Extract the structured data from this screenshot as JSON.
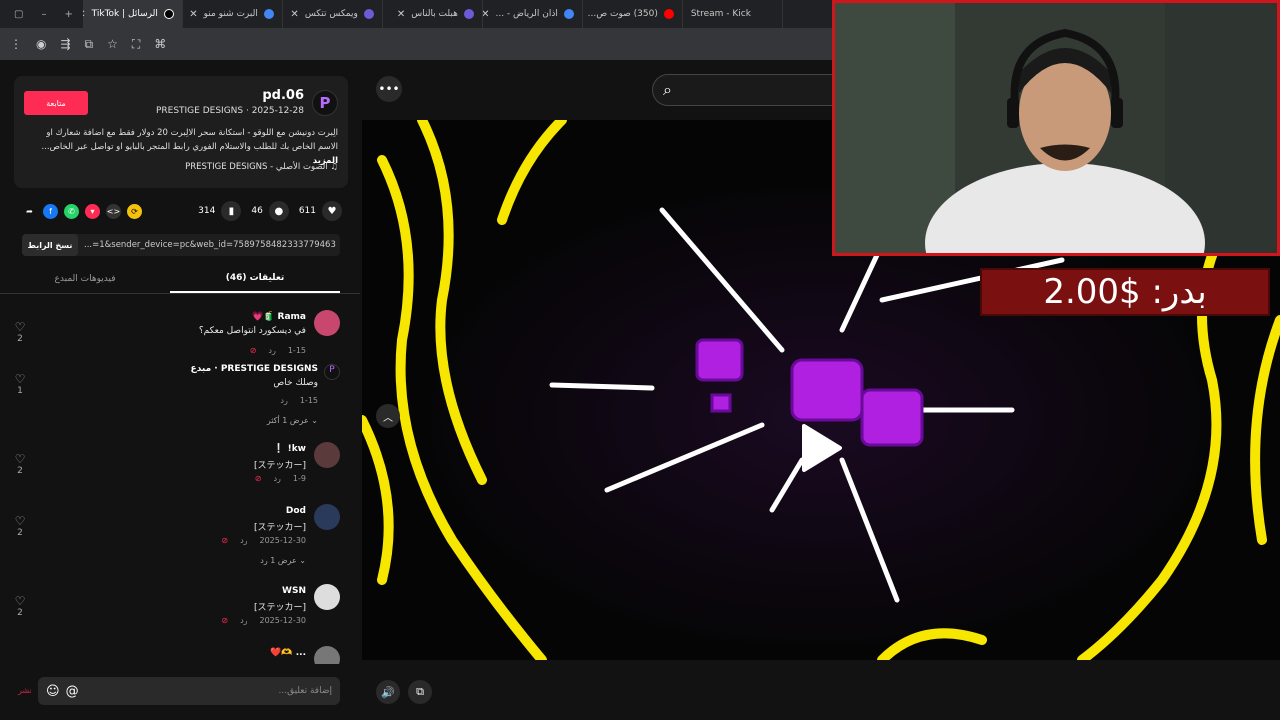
{
  "browser": {
    "tabs": [
      {
        "title": "Stream - Kick",
        "color": "#53fc18"
      },
      {
        "title": "(350) صوت ص...",
        "color": "#ff0000"
      },
      {
        "title": "اذان الرياض - ...",
        "color": "#4285f4"
      },
      {
        "title": "هبلت بالناس",
        "color": "#6b5bd6"
      },
      {
        "title": "ويمكس تتكس",
        "color": "#6b5bd6"
      },
      {
        "title": "البرت شنو منو",
        "color": "#4285f4"
      },
      {
        "title": "الرسائل | TikTok",
        "color": "#000000",
        "active": true
      }
    ],
    "window_controls": [
      "+",
      "–",
      "▢"
    ]
  },
  "post": {
    "author_name": "pd.06",
    "author_sub": "PRESTIGE DESIGNS · 2025-12-28",
    "follow_label": "متابعة",
    "description": "الِبرت دونيشن مع اللوقو - استكانة سحر الالِبرت 20 دولار فقط مع اضافة شعارك او الاسم الخاص بك للطلب والاستلام الفوري رابط المتجر بالبايو او تواصل عبر الخاص...",
    "more_label": "المزيد",
    "music": "الصوت الأصلي - PRESTIGE DESIGNS",
    "likes": "611",
    "comments_count": "46",
    "saves": "314",
    "link_url": "...=1&sender_device=pc&web_id=7589758482333779463",
    "copy_label": "نسخ الرابط"
  },
  "tabs": {
    "comments": "تعليقات (46)",
    "creator_videos": "فيديوهات المبدع"
  },
  "comments": [
    {
      "name": "Rama 🧃💗",
      "text": "في ديسكورد انتواصل معكم؟",
      "date": "1-15",
      "reply": "رد",
      "likes": "2",
      "avatar": "#c8476e"
    },
    {
      "name": "PRESTIGE DESIGNS · مبدع",
      "text": "وصلك خاص",
      "date": "1-15",
      "reply": "رد",
      "likes": "1",
      "avatar": "#111111",
      "view_more": "عرض 1 أكثر"
    },
    {
      "name": "kw! ❕",
      "text": "[ステッカー]",
      "date": "1-9",
      "reply": "رد",
      "likes": "2",
      "avatar": "#5a3a3a"
    },
    {
      "name": "Dod",
      "text": "[ステッカー]",
      "date": "2025-12-30",
      "reply": "رد",
      "likes": "2",
      "avatar": "#2a3a5a",
      "view_more": "عرض 1 رد"
    },
    {
      "name": "WSN",
      "text": "[ステッカー]",
      "date": "2025-12-30",
      "reply": "رد",
      "likes": "2",
      "avatar": "#dddddd"
    },
    {
      "name": "... 🫶❤️",
      "text": "",
      "date": "",
      "reply": "",
      "likes": "",
      "avatar": "#777777"
    }
  ],
  "input": {
    "placeholder": "إضافة تعليق...",
    "post_label": "نشر"
  },
  "overlay": {
    "donation_text": "بدر: $2.00"
  },
  "colors": {
    "accent": "#fe2c55",
    "webcam_border": "#d0161a",
    "donation_bg": "#7a1010"
  }
}
